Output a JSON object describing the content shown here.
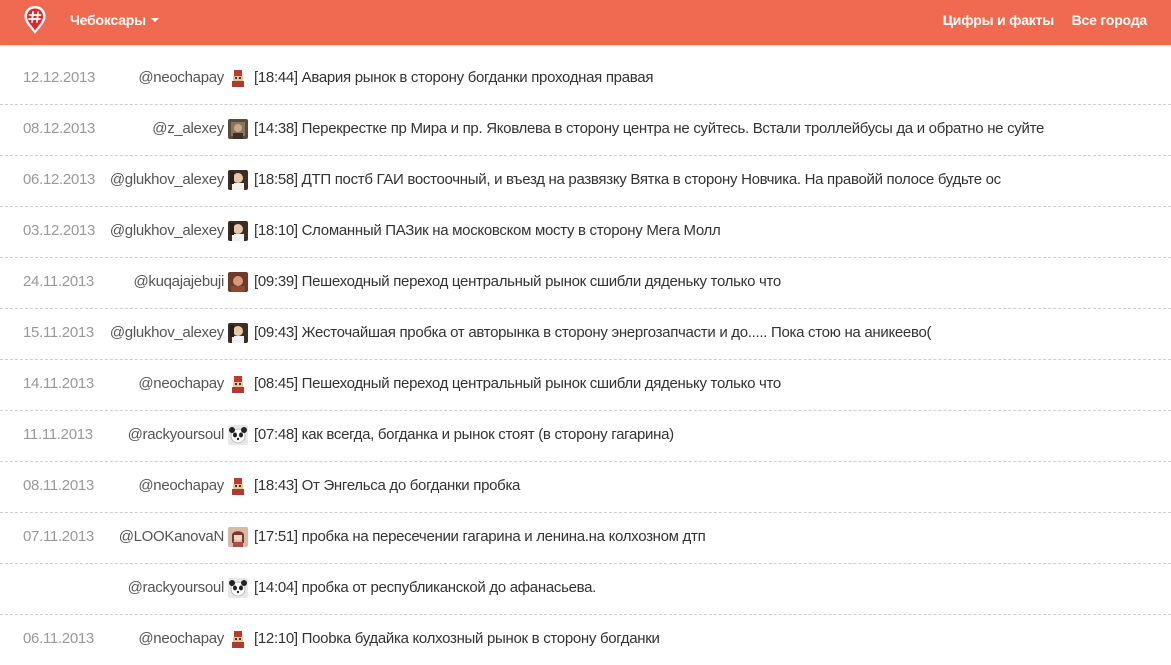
{
  "nav": {
    "logo_icon": "hashtag-pin-icon",
    "city": "Чебоксары",
    "links": [
      "Цифры и факты",
      "Все города"
    ]
  },
  "colors": {
    "navbar": "#ef6a50",
    "date": "#999999",
    "username": "#555555",
    "message": "#333333",
    "divider": "#cfcfcf"
  },
  "posts": [
    {
      "date": "12.12.2013",
      "user": "@neochapay",
      "avatar": "avatar-neochapay",
      "text": "[18:44] Авария рынок в сторону богданки проходная правая"
    },
    {
      "date": "08.12.2013",
      "user": "@z_alexey",
      "avatar": "avatar-z-alexey",
      "text": "[14:38] Перекрестке пр Мира и пр. Яковлева в сторону центра не суйтесь. Встали троллейбусы да и обратно не суйте"
    },
    {
      "date": "06.12.2013",
      "user": "@glukhov_alexey",
      "avatar": "avatar-glukhov-alexey",
      "text": "[18:58] ДТП постб ГАИ востоочный, и въезд на развязку Вятка в сторону Новчика. На правойй полосе будьте ос"
    },
    {
      "date": "03.12.2013",
      "user": "@glukhov_alexey",
      "avatar": "avatar-glukhov-alexey",
      "text": "[18:10] Сломанный ПАЗик на московском мосту в сторону Мега Молл"
    },
    {
      "date": "24.11.2013",
      "user": "@kuqajajebuji",
      "avatar": "avatar-kuqajajebuji",
      "text": "[09:39] Пешеходный переход центральный рынок сшибли дяденьку только что"
    },
    {
      "date": "15.11.2013",
      "user": "@glukhov_alexey",
      "avatar": "avatar-glukhov-alexey",
      "text": "[09:43] Жесточайшая пробка от авторынка в сторону энергозапчасти и до..... Пока стою на аникеево("
    },
    {
      "date": "14.11.2013",
      "user": "@neochapay",
      "avatar": "avatar-neochapay",
      "text": "[08:45] Пешеходный переход центральный рынок сшибли дяденьку только что"
    },
    {
      "date": "11.11.2013",
      "user": "@rackyoursoul",
      "avatar": "avatar-rackyoursoul",
      "text": "[07:48] как всегда, богданка и рынок стоят (в сторону гагарина)"
    },
    {
      "date": "08.11.2013",
      "user": "@neochapay",
      "avatar": "avatar-neochapay",
      "text": "[18:43] От Энгельса до богданки пробка"
    },
    {
      "date": "07.11.2013",
      "user": "@LOOKanovaN",
      "avatar": "avatar-lookanovan",
      "text": "[17:51] пробка на пересечении гагарина и ленина.на колхозном дтп"
    },
    {
      "date": "",
      "user": "@rackyoursoul",
      "avatar": "avatar-rackyoursoul",
      "text": "[14:04] пробка от республиканской до афанасьева."
    },
    {
      "date": "06.11.2013",
      "user": "@neochapay",
      "avatar": "avatar-neochapay",
      "text": "[12:10] Поobка будайка колхозный рынок в сторону богданки"
    }
  ]
}
